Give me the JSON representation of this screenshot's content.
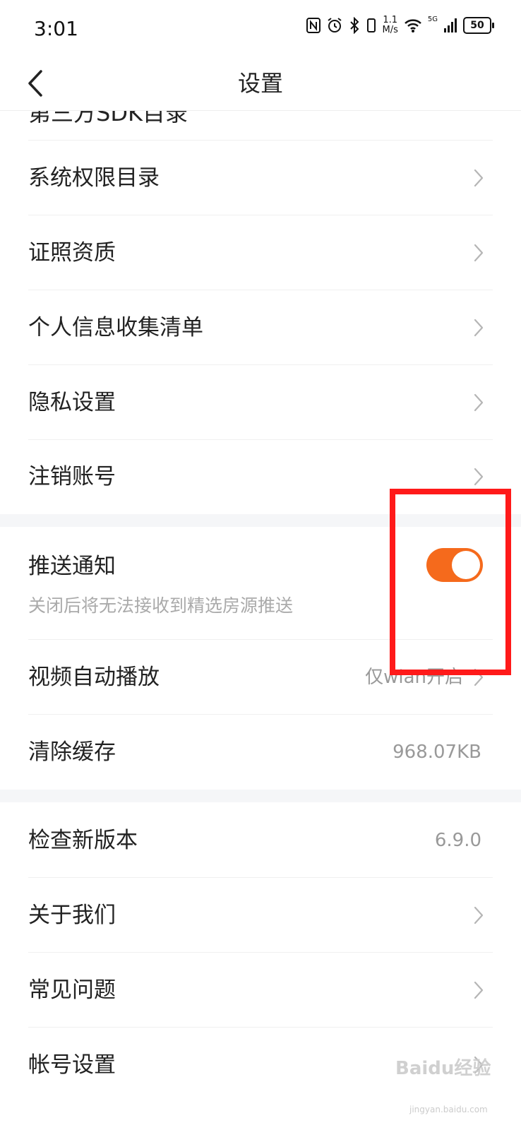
{
  "status_bar": {
    "time": "3:01",
    "speed_value": "1.1",
    "speed_unit": "M/s",
    "signal_label": "5G",
    "battery": "50",
    "icons": [
      "nfc-icon",
      "alarm-icon",
      "bluetooth-icon",
      "vibrate-icon",
      "wifi-icon",
      "signal-icon",
      "battery-icon"
    ]
  },
  "header": {
    "title": "设置",
    "back_icon": "chevron-left-icon"
  },
  "top_cut_row": "第三方SDK目录",
  "group1": [
    {
      "label": "系统权限目录"
    },
    {
      "label": "证照资质"
    },
    {
      "label": "个人信息收集清单"
    },
    {
      "label": "隐私设置"
    },
    {
      "label": "注销账号"
    }
  ],
  "push": {
    "title": "推送通知",
    "subtitle": "关闭后将无法接收到精选房源推送",
    "enabled": true,
    "toggle_color": "#f56a1c"
  },
  "video": {
    "label": "视频自动播放",
    "value": "仅wlan开启"
  },
  "cache": {
    "label": "清除缓存",
    "value": "968.07KB"
  },
  "group3": [
    {
      "label": "检查新版本",
      "value": "6.9.0"
    },
    {
      "label": "关于我们"
    },
    {
      "label": "常见问题"
    },
    {
      "label": "帐号设置"
    }
  ],
  "watermark": {
    "text": "Baidu经验",
    "url": "jingyan.baidu.com"
  },
  "colors": {
    "accent": "#f56a1c",
    "annotation": "#ff1a1a",
    "section_gap": "#f5f6f8"
  }
}
